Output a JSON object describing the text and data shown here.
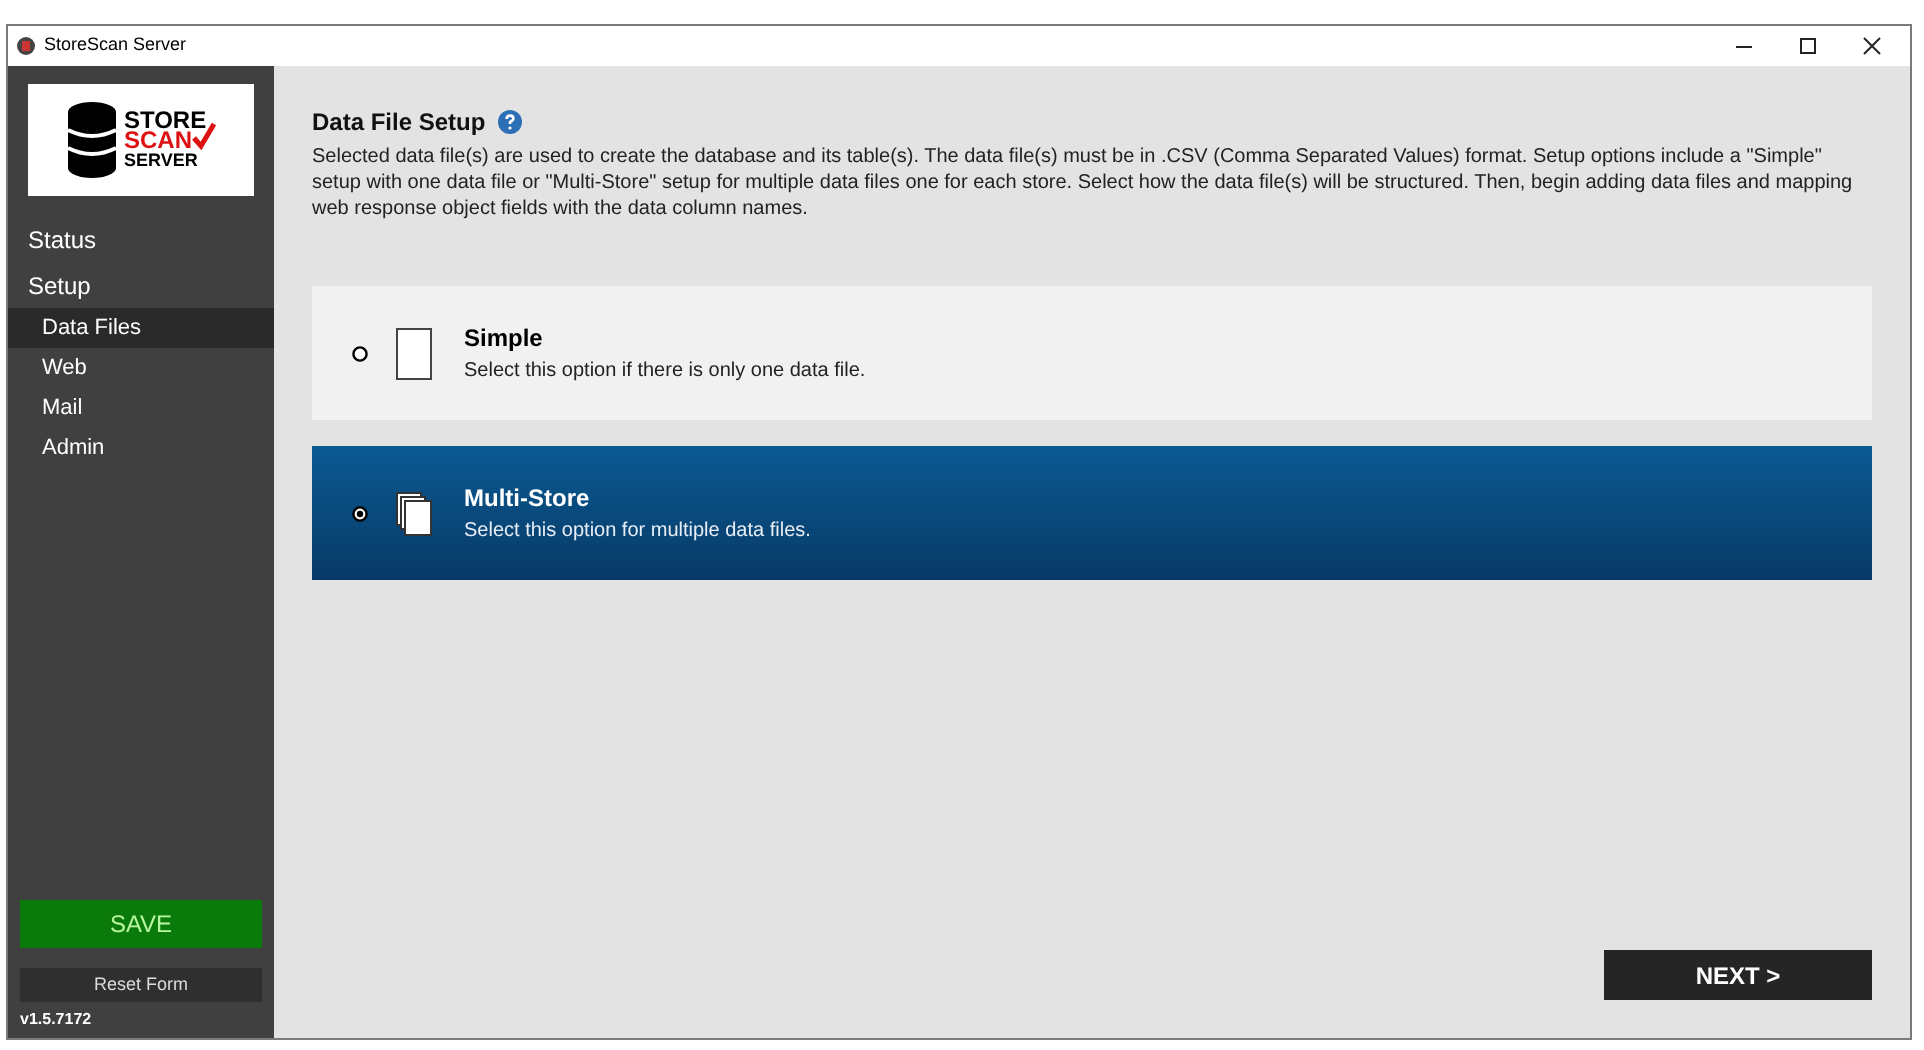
{
  "window": {
    "title": "StoreScan Server"
  },
  "logo": {
    "line_1": "STORE",
    "line_2": "SCAN",
    "line_3": "SERVER"
  },
  "sidebar": {
    "sections": [
      {
        "label": "Status"
      },
      {
        "label": "Setup",
        "children": [
          {
            "label": "Data Files",
            "selected": true
          },
          {
            "label": "Web",
            "selected": false
          },
          {
            "label": "Mail",
            "selected": false
          },
          {
            "label": "Admin",
            "selected": false
          }
        ]
      }
    ],
    "save": "SAVE",
    "reset": "Reset Form",
    "version": "v1.5.7172"
  },
  "page": {
    "title": "Data File Setup",
    "description": "Selected data file(s) are used to create the database and its table(s).  The data file(s) must be in .CSV (Comma Separated Values) format.  Setup options include a \"Simple\" setup with one data file or \"Multi-Store\" setup for multiple data files one for each store.  Select how the data file(s) will be structured.  Then, begin adding data files and mapping web response object fields with the data column names.",
    "options": [
      {
        "kind": "single",
        "title": "Simple",
        "description": "Select this option if there is only one data file.",
        "selected": false
      },
      {
        "kind": "multi",
        "title": "Multi-Store",
        "description": "Select this option for multiple data files.",
        "selected": true
      }
    ],
    "next": "NEXT >"
  }
}
